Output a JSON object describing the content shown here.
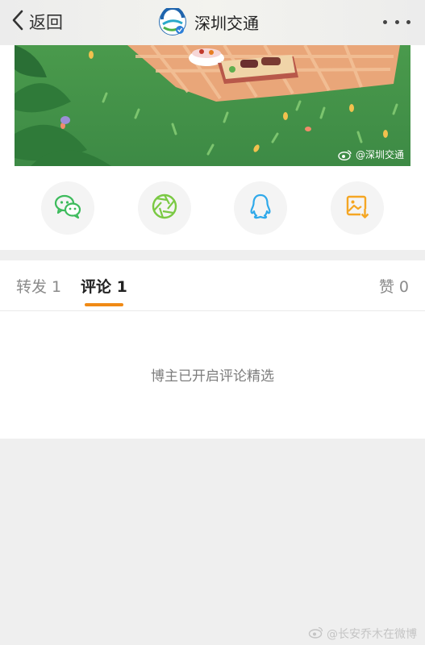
{
  "nav": {
    "back_label": "返回",
    "title": "深圳交通",
    "back_icon": "chevron-left-icon",
    "more_icon": "ellipsis-icon",
    "logo_icon": "shenzhen-transport-logo"
  },
  "banner": {
    "watermark": "@深圳交通",
    "watermark_icon": "weibo-icon"
  },
  "share": {
    "buttons": [
      {
        "name": "wechat",
        "icon": "wechat-icon",
        "color": "#3dbb5c"
      },
      {
        "name": "moments",
        "icon": "aperture-icon",
        "color": "#7ac943"
      },
      {
        "name": "qq",
        "icon": "qq-penguin-icon",
        "color": "#2fa9ea"
      },
      {
        "name": "save-image",
        "icon": "save-image-icon",
        "color": "#f5a623"
      }
    ]
  },
  "tabs": {
    "repost": "转发 1",
    "comment": "评论 1",
    "like": "赞 0",
    "active": "comment",
    "accent_color": "#f08a15"
  },
  "comments": {
    "notice": "博主已开启评论精选"
  },
  "footer": {
    "watermark": "@长安乔木在微博"
  }
}
